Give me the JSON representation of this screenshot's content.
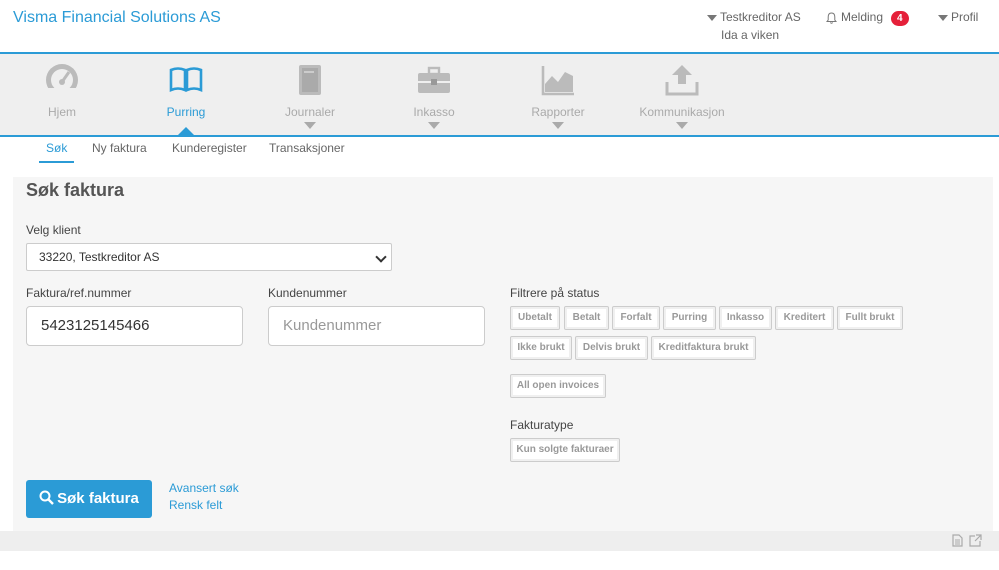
{
  "header": {
    "brand": "Visma Financial Solutions AS",
    "creditor": "Testkreditor AS",
    "user": "Ida a viken",
    "messages_label": "Melding",
    "messages_count": "4",
    "profile_label": "Profil"
  },
  "nav": {
    "items": [
      {
        "label": "Hjem",
        "icon": "dashboard-icon"
      },
      {
        "label": "Purring",
        "icon": "book-icon"
      },
      {
        "label": "Journaler",
        "icon": "journal-icon"
      },
      {
        "label": "Inkasso",
        "icon": "briefcase-icon"
      },
      {
        "label": "Rapporter",
        "icon": "chart-icon"
      },
      {
        "label": "Kommunikasjon",
        "icon": "upload-icon"
      }
    ],
    "active": "Purring"
  },
  "subnav": {
    "items": [
      "Søk",
      "Ny faktura",
      "Kunderegister",
      "Transaksjoner"
    ],
    "active": "Søk"
  },
  "form": {
    "title": "Søk faktura",
    "client_label": "Velg klient",
    "client_value": "33220, Testkreditor AS",
    "invoice_label": "Faktura/ref.nummer",
    "invoice_value": "5423125145466",
    "customer_label": "Kundenummer",
    "customer_placeholder": "Kundenummer",
    "status_label": "Filtrere på status",
    "status_buttons": [
      "Ubetalt",
      "Betalt",
      "Forfalt",
      "Purring",
      "Inkasso",
      "Kreditert",
      "Fullt brukt",
      "Ikke brukt",
      "Delvis brukt",
      "Kreditfaktura brukt"
    ],
    "all_open_label": "All open invoices",
    "type_label": "Fakturatype",
    "type_button": "Kun solgte fakturaer",
    "search_button": "Søk faktura",
    "advanced_link": "Avansert søk",
    "clear_link": "Rensk felt"
  },
  "colors": {
    "accent": "#2b9bd6",
    "badge": "#e5203a"
  }
}
